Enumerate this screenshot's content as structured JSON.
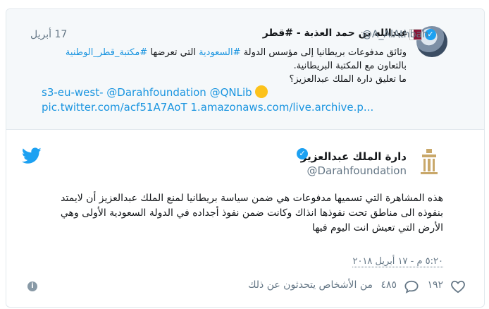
{
  "quoted_tweet": {
    "name": "عبدالله بن حمد العذبة - #قطر",
    "handle": "@A_AlAthbah",
    "date": "17 أبريل",
    "text_line1_pre": "وثائق مدفوعات بريطانيا إلى مؤسس الدولة ",
    "hashtag_saudi": "#السعودية",
    "text_line1_post": " التي تعرضها ",
    "hashtag_library": "#مكتبة_قطر_الوطنية",
    "text_line2": "بالتعاون مع المكتبة البريطانية.",
    "text_line3": "ما تعليق دارة الملك عبدالعزيز؟",
    "mentions_line": "s3-eu-west- @Darahfoundation @QNLib",
    "link_line": "pic.twitter.com/acf51A7AoT 1.amazonaws.com/live.archive.p..."
  },
  "main_tweet": {
    "name": "دارة الملك عبدالعزيز",
    "handle": "@Darahfoundation",
    "text": "هذه المشاهرة التي تسميها مدفوعات هي ضمن سياسة بريطانيا لمنع الملك عبدالعزيز أن لايمتد بنفوذه الى مناطق تحت نفوذها انذاك وكانت ضمن نفوذ أجداده في الدولة السعودية الأولى وهي الأرض التي تعيش انت اليوم فيها",
    "timestamp": "٥:٢٠ م - ١٧ أبريل ٢٠١٨"
  },
  "actions": {
    "likes": "١٩٢",
    "replies": "٤٨٥",
    "people_talking": "من الأشخاص يتحدثون عن ذلك"
  },
  "icons": {
    "verified": "verified-badge-icon",
    "twitter": "twitter-bird-icon",
    "info": "info-icon",
    "heart": "heart-icon",
    "reply": "reply-bubble-icon"
  },
  "colors": {
    "link": "#1b95e0",
    "twitter_blue": "#1da1f2",
    "muted": "#657786",
    "quoted_bg": "#f5f8fa"
  }
}
